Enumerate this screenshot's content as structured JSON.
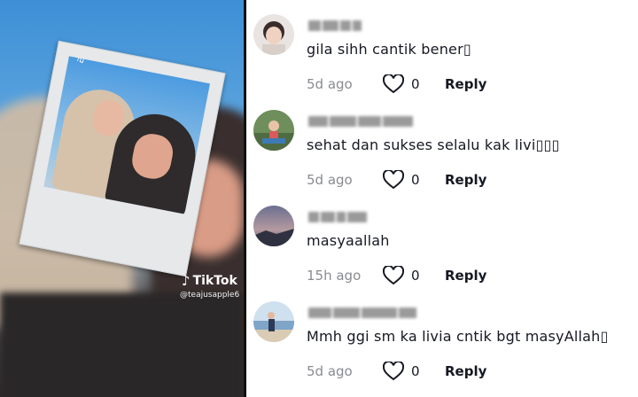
{
  "watermark": {
    "brand": "TikTok",
    "handle": "@teajusapple6"
  },
  "polaroid": {
    "caption": "리 나"
  },
  "comments": [
    {
      "text": "gila sihh cantik bener▯",
      "time": "5d ago",
      "likes": "0",
      "reply": "Reply",
      "avatar": "baby-photo"
    },
    {
      "text": "sehat dan sukses selalu kak livi▯▯▯",
      "time": "5d ago",
      "likes": "0",
      "reply": "Reply",
      "avatar": "outdoor-photo"
    },
    {
      "text": "masyaallah",
      "time": "15h ago",
      "likes": "0",
      "reply": "Reply",
      "avatar": "dusk-landscape"
    },
    {
      "text": "Mmh ggi sm ka livia cntik bgt masyAllah▯",
      "time": "5d ago",
      "likes": "0",
      "reply": "Reply",
      "avatar": "beach-photo"
    }
  ],
  "colors": {
    "text": "#161823",
    "muted": "#8a8b91"
  }
}
